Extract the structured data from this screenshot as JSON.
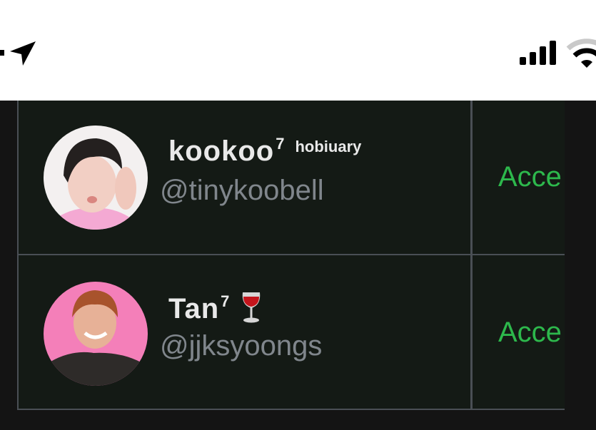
{
  "status_bar": {
    "icons": [
      "location-arrow-icon",
      "cellular-signal-icon",
      "wifi-icon"
    ]
  },
  "requests": [
    {
      "display_name": "kookoo",
      "superscript": "7",
      "name_suffix": "hobiuary",
      "handle": "@tinykoobell",
      "action_label": "Acce"
    },
    {
      "display_name": "Tan",
      "superscript": "7",
      "name_suffix_icon": "wine-glass-icon",
      "handle": "@jjksyoongs",
      "action_label": "Acce"
    }
  ],
  "colors": {
    "accent_green": "#2db84c",
    "row_background": "#141a15",
    "border": "#4a4f55",
    "handle_gray": "#80868c"
  }
}
